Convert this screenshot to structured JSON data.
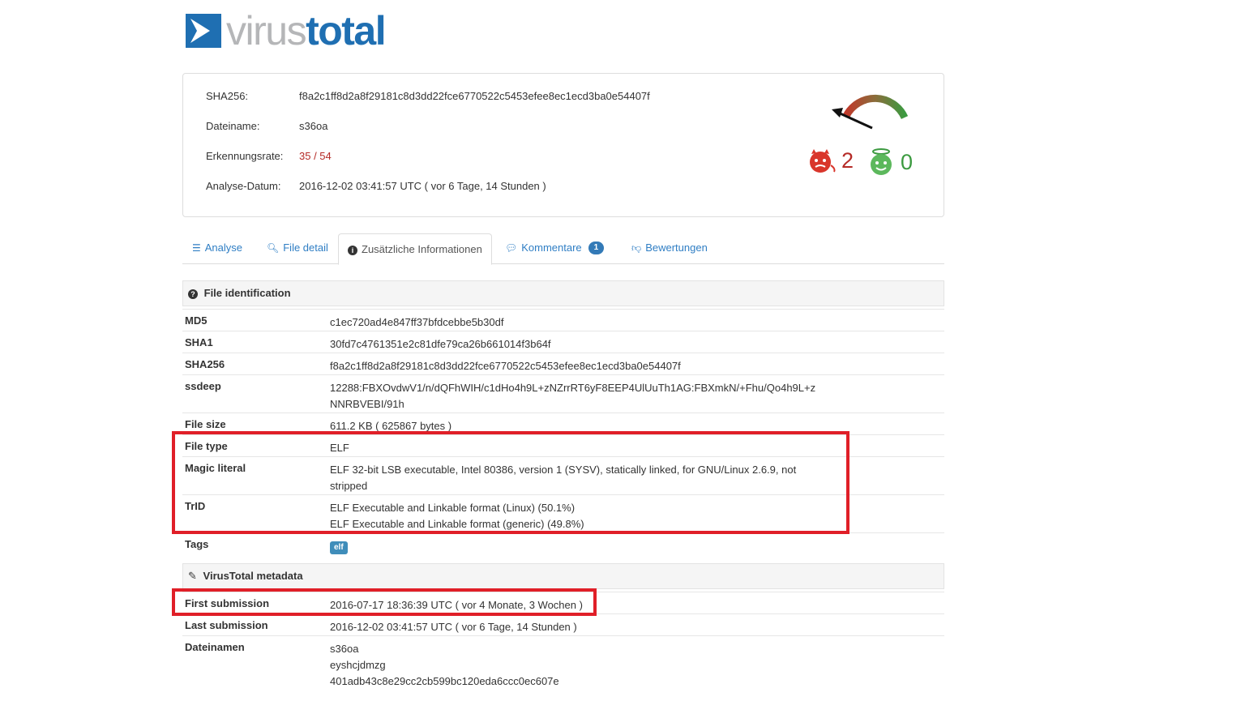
{
  "logo": {
    "part1": "virus",
    "part2": "total"
  },
  "summary": {
    "sha256_label": "SHA256:",
    "sha256": "f8a2c1ff8d2a8f29181c8d3dd22fce6770522c5453efee8ec1ecd3ba0e54407f",
    "filename_label": "Dateiname:",
    "filename": "s36oa",
    "detection_label": "Erkennungsrate:",
    "detection": "35 / 54",
    "date_label": "Analyse-Datum:",
    "date": "2016-12-02 03:41:57 UTC ( vor 6 Tage, 14 Stunden )",
    "bad_votes": "2",
    "good_votes": "0"
  },
  "tabs": [
    {
      "label": "Analyse",
      "icon": "list-icon"
    },
    {
      "label": "File detail",
      "icon": "search-icon"
    },
    {
      "label": "Zusätzliche Informationen",
      "icon": "info-icon"
    },
    {
      "label": "Kommentare",
      "icon": "comment-icon",
      "badge": "1"
    },
    {
      "label": "Bewertungen",
      "icon": "thumbs-down-icon"
    }
  ],
  "file_identification": {
    "title": "File identification",
    "rows": [
      {
        "key": "MD5",
        "value": [
          "c1ec720ad4e847ff37bfdcebbe5b30df"
        ]
      },
      {
        "key": "SHA1",
        "value": [
          "30fd7c4761351e2c81dfe79ca26b661014f3b64f"
        ]
      },
      {
        "key": "SHA256",
        "value": [
          "f8a2c1ff8d2a8f29181c8d3dd22fce6770522c5453efee8ec1ecd3ba0e54407f"
        ]
      },
      {
        "key": "ssdeep",
        "value": [
          "12288:FBXOvdwV1/n/dQFhWIH/c1dHo4h9L+zNZrrRT6yF8EEP4UlUuTh1AG:FBXmkN/+Fhu/Qo4h9L+z",
          "NNRBVEBI/91h"
        ]
      },
      {
        "key": "File size",
        "value": [
          "611.2 KB ( 625867 bytes )"
        ]
      },
      {
        "key": "File type",
        "value": [
          "ELF"
        ]
      },
      {
        "key": "Magic literal",
        "value": [
          "ELF 32-bit LSB executable, Intel 80386, version 1 (SYSV), statically linked, for GNU/Linux 2.6.9, not",
          "stripped"
        ]
      },
      {
        "key": "TrID",
        "value": [
          "ELF Executable and Linkable format (Linux) (50.1%)",
          "ELF Executable and Linkable format (generic) (49.8%)"
        ]
      },
      {
        "key": "Tags",
        "tag": "elf"
      }
    ]
  },
  "metadata": {
    "title": "VirusTotal metadata",
    "rows": [
      {
        "key": "First submission",
        "value": [
          "2016-07-17 18:36:39 UTC ( vor 4 Monate, 3 Wochen )"
        ]
      },
      {
        "key": "Last submission",
        "value": [
          "2016-12-02 03:41:57 UTC ( vor 6 Tage, 14 Stunden )"
        ]
      },
      {
        "key": "Dateinamen",
        "value": [
          "s36oa",
          "eyshcjdmzg",
          "401adb43c8e29cc2cb599bc120eda6ccc0ec607e"
        ]
      }
    ]
  },
  "colors": {
    "accent": "#1f6fb2",
    "malicious": "#b52b27",
    "harmless": "#3c9a40",
    "highlight": "#e01f28"
  }
}
